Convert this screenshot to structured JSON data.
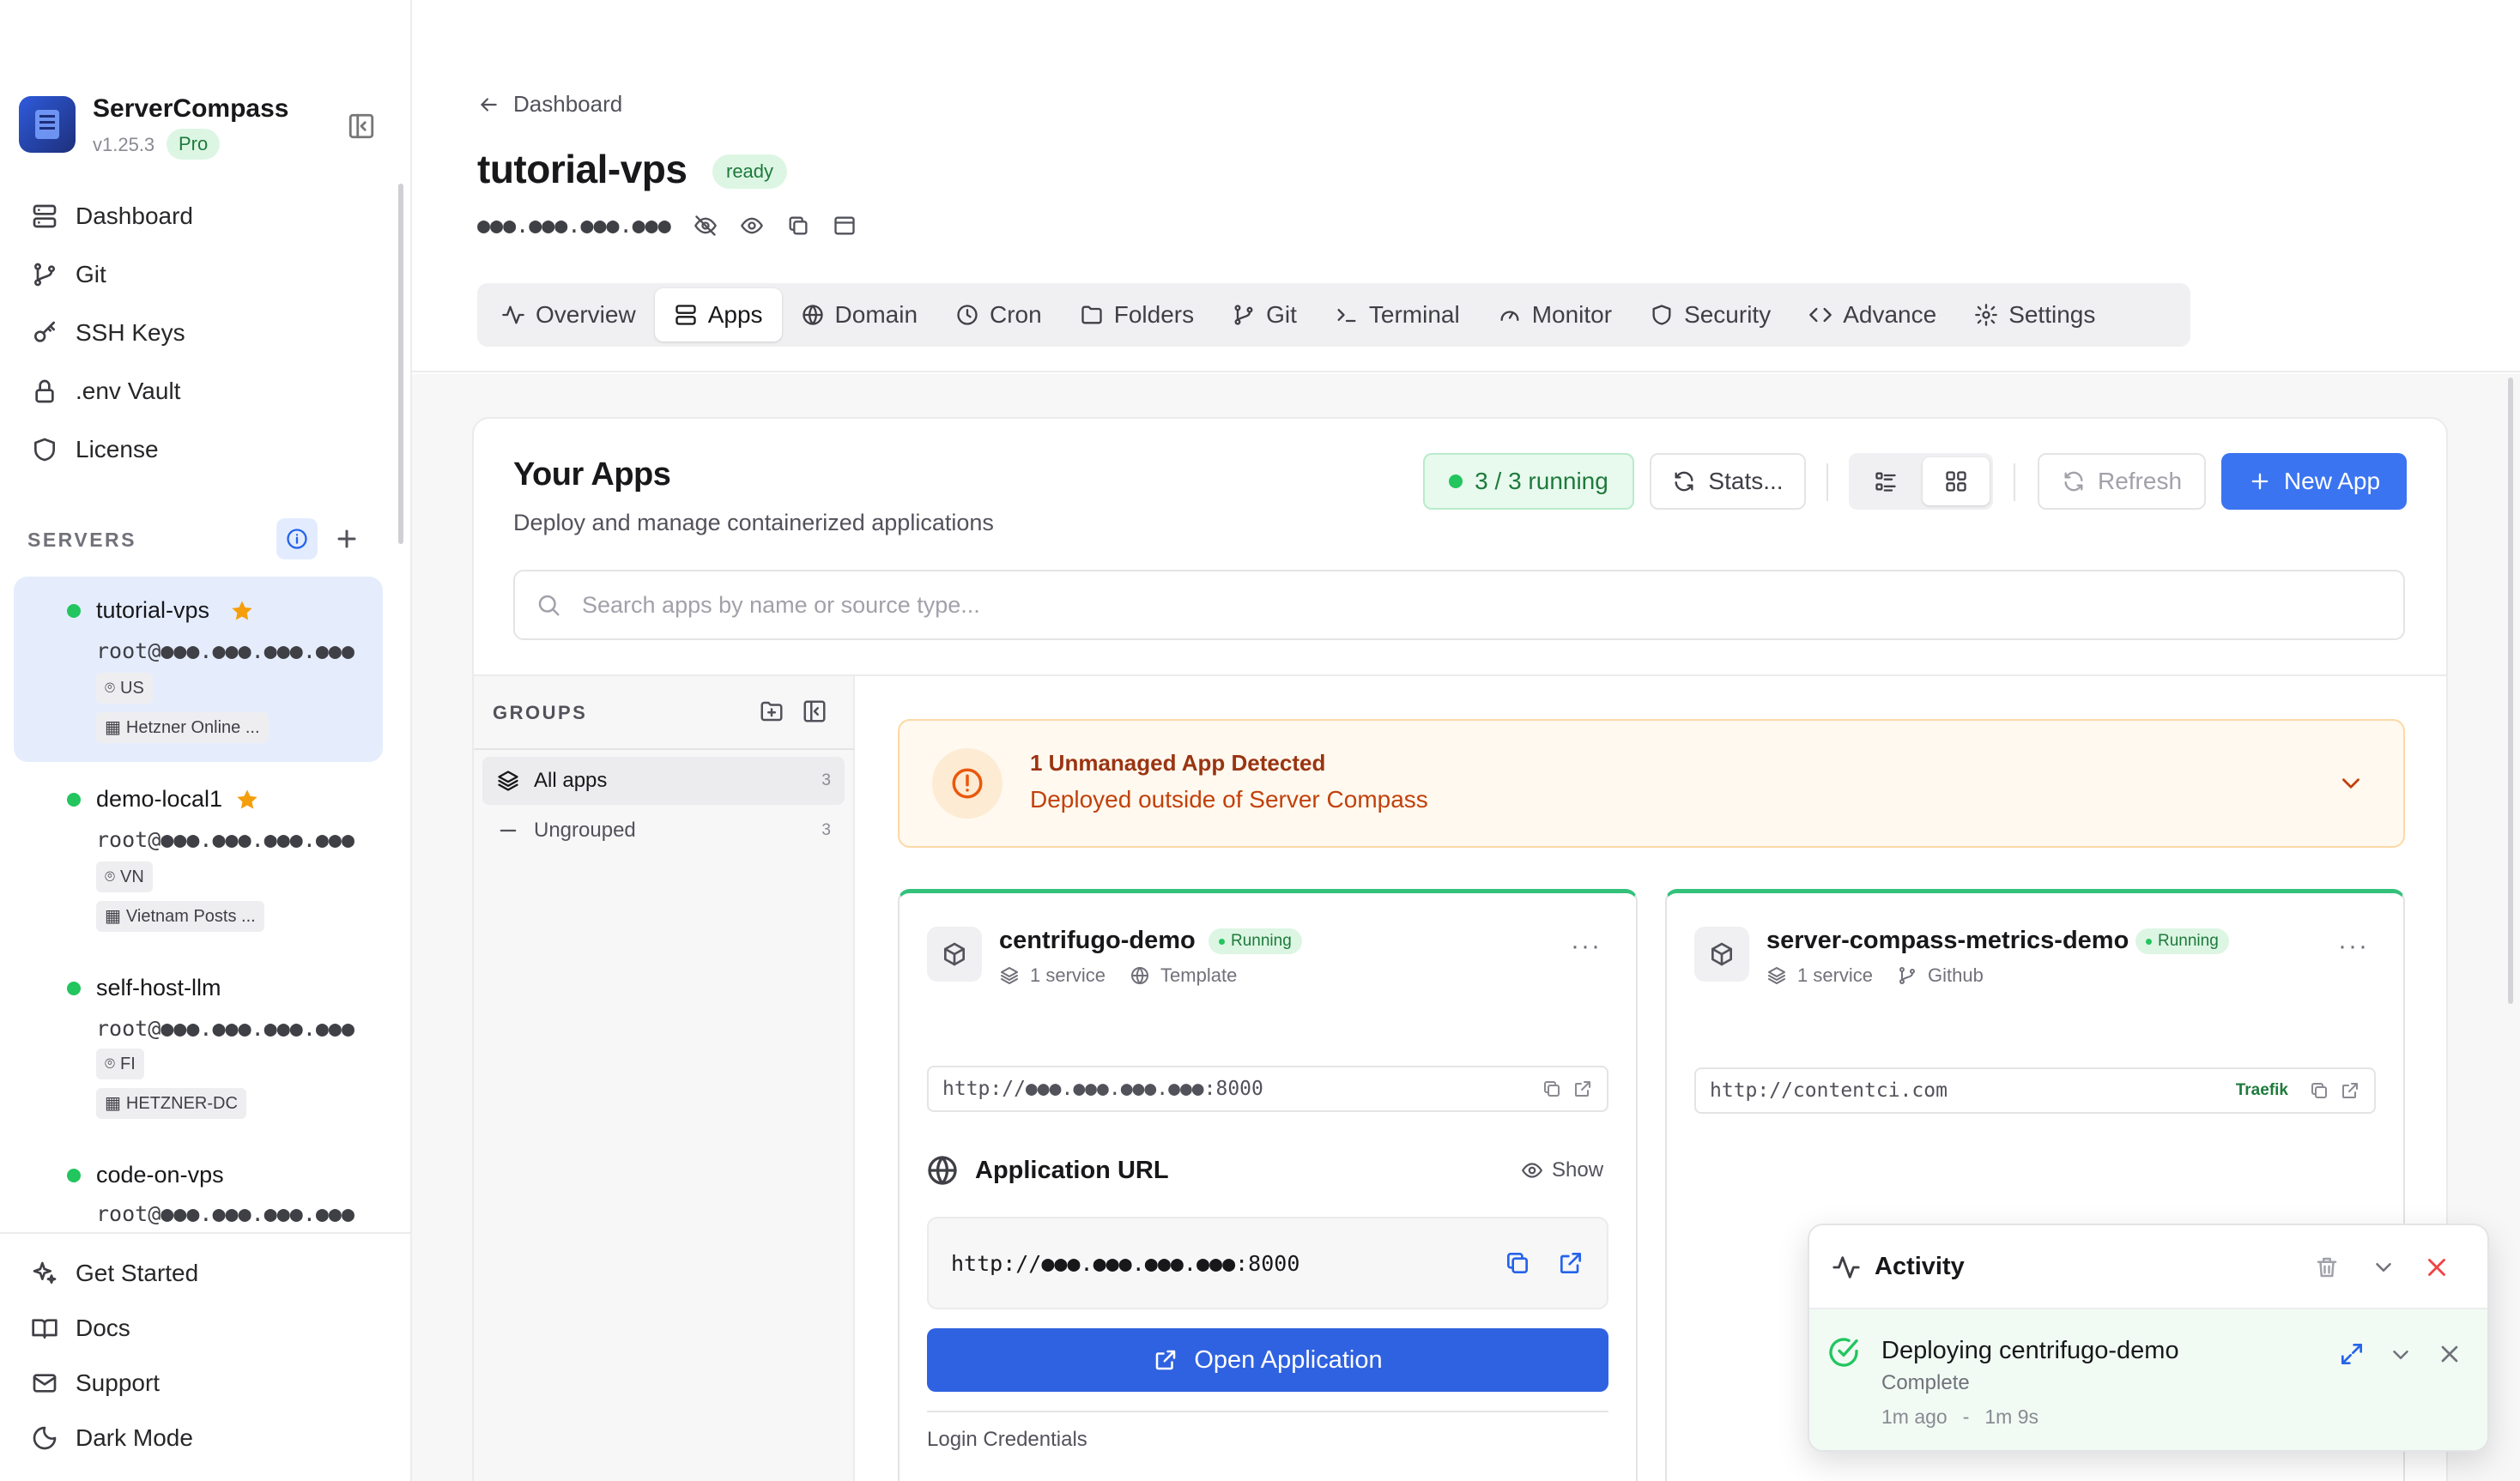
{
  "sidebar": {
    "app_name": "ServerCompass",
    "version": "v1.25.3",
    "plan": "Pro",
    "nav": [
      {
        "label": "Dashboard",
        "icon": "server-icon"
      },
      {
        "label": "Git",
        "icon": "git-branch-icon"
      },
      {
        "label": "SSH Keys",
        "icon": "key-icon"
      },
      {
        "label": ".env Vault",
        "icon": "lock-icon"
      },
      {
        "label": "License",
        "icon": "shield-icon"
      }
    ],
    "servers_heading": "SERVERS",
    "servers": [
      {
        "name": "tutorial-vps",
        "user": "root@●●●.●●●.●●●.●●●",
        "region": "US",
        "provider": "Hetzner Online ...",
        "starred": true,
        "status_color": "#22c55e",
        "active": true
      },
      {
        "name": "demo-local1",
        "user": "root@●●●.●●●.●●●.●●●",
        "region": "VN",
        "provider": "Vietnam Posts ...",
        "starred": true,
        "status_color": "#22c55e"
      },
      {
        "name": "self-host-llm",
        "user": "root@●●●.●●●.●●●.●●●",
        "region": "FI",
        "provider": "HETZNER-DC",
        "starred": false,
        "status_color": "#22c55e"
      },
      {
        "name": "code-on-vps",
        "user": "root@●●●.●●●.●●●.●●●",
        "starred": false,
        "status_color": "#22c55e"
      }
    ],
    "bottom": [
      {
        "label": "Get Started",
        "icon": "sparkles-icon"
      },
      {
        "label": "Docs",
        "icon": "book-icon"
      },
      {
        "label": "Support",
        "icon": "mail-icon"
      },
      {
        "label": "Dark Mode",
        "icon": "moon-icon"
      }
    ]
  },
  "header": {
    "back_label": "Dashboard",
    "title": "tutorial-vps",
    "status": "ready",
    "ip_masked": "●●●.●●●.●●●.●●●",
    "tabs": [
      {
        "label": "Overview",
        "icon": "activity-icon"
      },
      {
        "label": "Apps",
        "icon": "server-icon",
        "active": true
      },
      {
        "label": "Domain",
        "icon": "globe-icon"
      },
      {
        "label": "Cron",
        "icon": "clock-icon"
      },
      {
        "label": "Folders",
        "icon": "folder-icon"
      },
      {
        "label": "Git",
        "icon": "git-branch-icon"
      },
      {
        "label": "Terminal",
        "icon": "terminal-icon"
      },
      {
        "label": "Monitor",
        "icon": "gauge-icon"
      },
      {
        "label": "Security",
        "icon": "shield-icon"
      },
      {
        "label": "Advance",
        "icon": "code-icon"
      },
      {
        "label": "Settings",
        "icon": "gear-icon"
      }
    ]
  },
  "apps": {
    "title": "Your Apps",
    "subtitle": "Deploy and manage containerized applications",
    "running": "3 / 3 running",
    "stats": "Stats...",
    "refresh": "Refresh",
    "new_app": "New App",
    "search_placeholder": "Search apps by name or source type...",
    "groups_heading": "GROUPS",
    "groups": [
      {
        "label": "All apps",
        "count": "3",
        "active": true
      },
      {
        "label": "Ungrouped",
        "count": "3"
      }
    ],
    "warning": {
      "title": "1 Unmanaged App Detected",
      "subtitle": "Deployed outside of Server Compass"
    },
    "cards": [
      {
        "name": "centrifugo-demo",
        "status": "Running",
        "services": "1 service",
        "source": "Template",
        "url": "http://●●●.●●●.●●●.●●●:8000",
        "app_url_heading": "Application URL",
        "show_label": "Show",
        "app_url": "http://●●●.●●●.●●●.●●●:8000",
        "open_label": "Open Application",
        "credentials_label": "Login Credentials"
      },
      {
        "name": "server-compass-metrics-demo",
        "status": "Running",
        "services": "1 service",
        "source": "Github",
        "url": "http://contentci.com",
        "proxy": "Traefik"
      }
    ]
  },
  "activity": {
    "title": "Activity",
    "item_title": "Deploying centrifugo-demo",
    "item_status": "Complete",
    "item_time": "1m ago",
    "item_sep": "-",
    "item_duration": "1m 9s"
  },
  "colors": {
    "accent": "#2563eb",
    "running": "#22c55e",
    "warning": "#ea580c",
    "danger": "#ef4444"
  }
}
